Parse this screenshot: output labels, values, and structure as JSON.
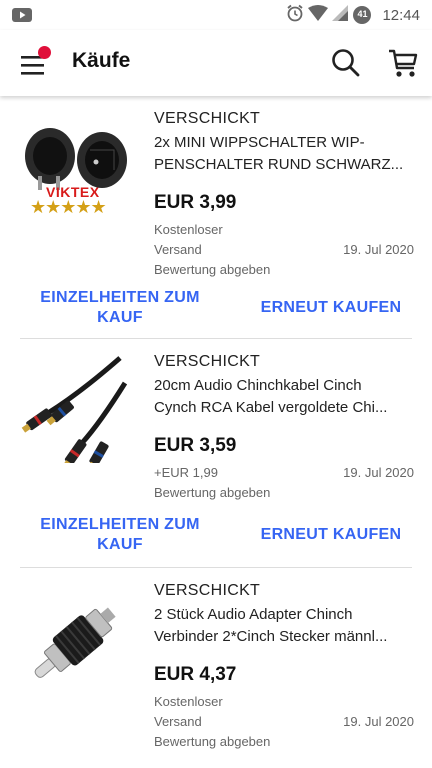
{
  "statusbar": {
    "time": "12:44",
    "battery_level": "41"
  },
  "appbar": {
    "title": "Käufe"
  },
  "orders": [
    {
      "status": "VERSCHICKT",
      "title_line1": "2x MINI WIPPSCHALTER WIP-",
      "title_line2": "PENSCHALTER RUND SCHWARZ...",
      "price": "EUR 3,99",
      "shipping_line1": "Kostenloser",
      "shipping_line2": "Versand",
      "date": "19. Jul 2020",
      "feedback": "Bewertung abgeben",
      "details_label_1": "EINZELHEITEN ZUM",
      "details_label_2": "KAUF",
      "rebuy_label": "ERNEUT KAUFEN",
      "brand_watermark": "VIKTEX",
      "stars": 5
    },
    {
      "status": "VERSCHICKT",
      "title_line1": "20cm Audio Chinchkabel Cinch",
      "title_line2": "Cynch RCA Kabel vergoldete Chi...",
      "price": "EUR 3,59",
      "shipping_line1": "+EUR 1,99",
      "shipping_line2": "",
      "date": "19. Jul 2020",
      "feedback": "Bewertung abgeben",
      "details_label_1": "EINZELHEITEN ZUM",
      "details_label_2": "KAUF",
      "rebuy_label": "ERNEUT KAUFEN"
    },
    {
      "status": "VERSCHICKT",
      "title_line1": "2 Stück Audio Adapter Chinch",
      "title_line2": "Verbinder 2*Cinch Stecker männl...",
      "price": "EUR 4,37",
      "shipping_line1": "Kostenloser",
      "shipping_line2": "Versand",
      "date": "19. Jul 2020",
      "feedback": "Bewertung abgeben"
    }
  ],
  "colors": {
    "link": "#3665f3",
    "badge": "#e0103a"
  }
}
